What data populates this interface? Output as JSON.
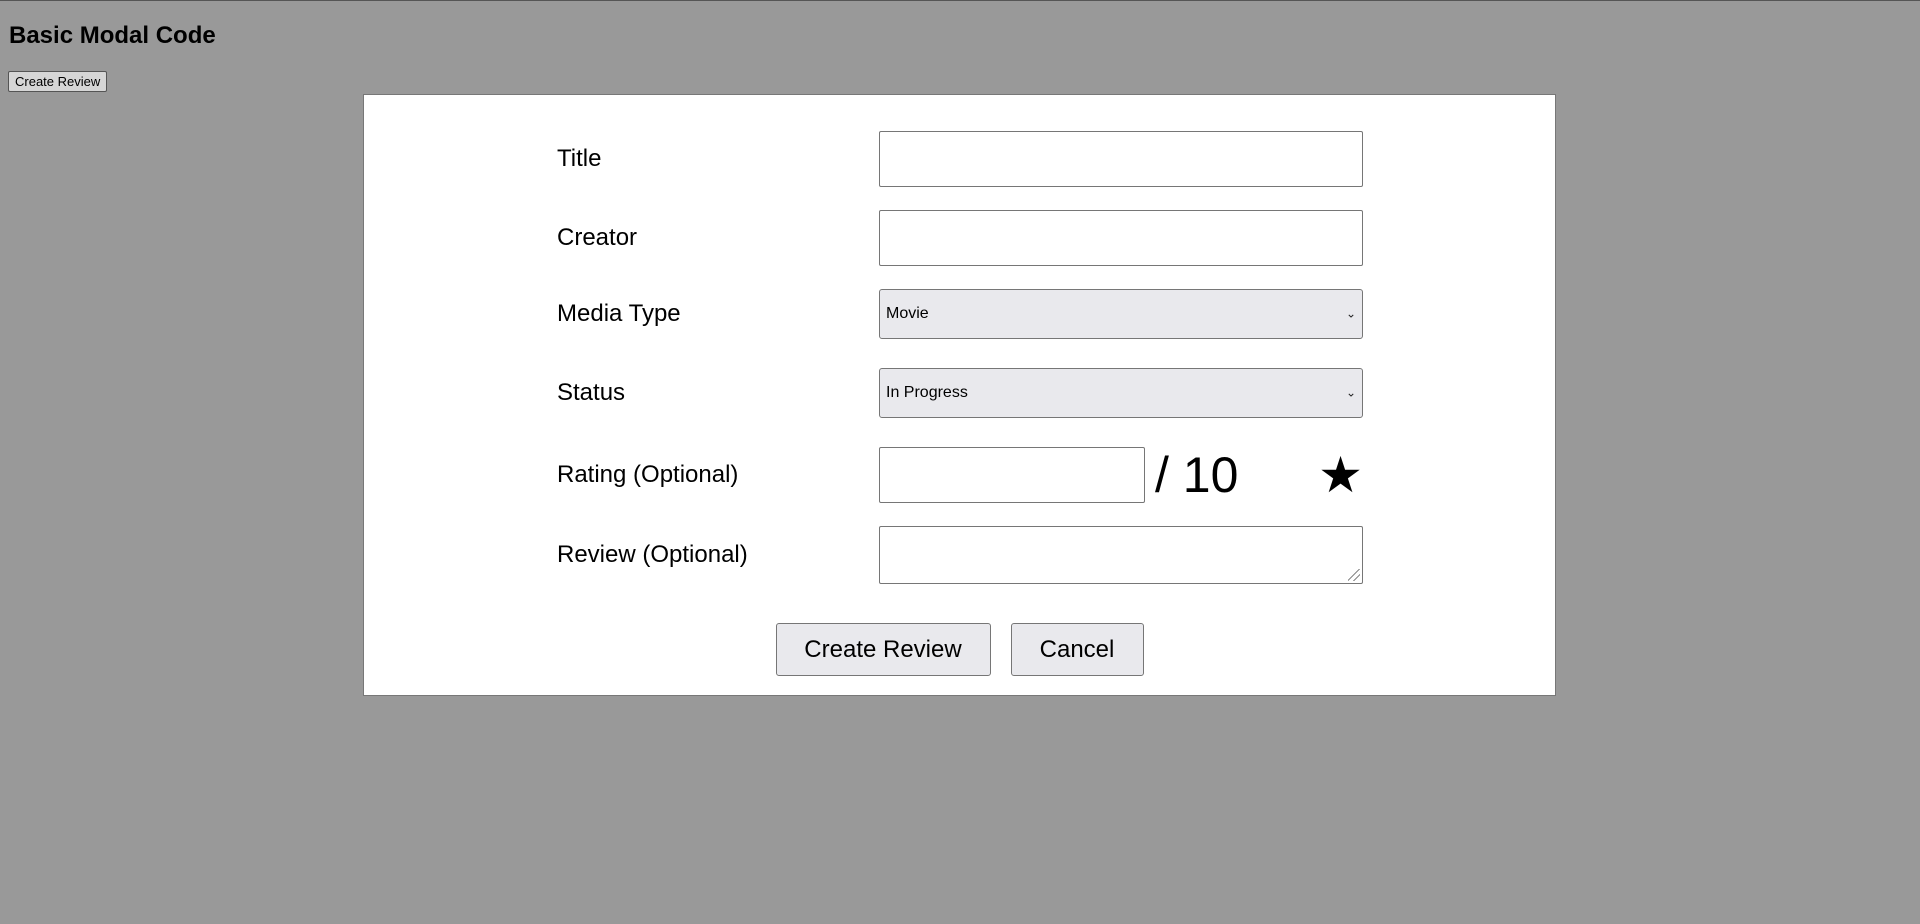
{
  "page": {
    "title": "Basic Modal Code",
    "open_button_label": "Create Review"
  },
  "modal": {
    "fields": {
      "title": {
        "label": "Title",
        "value": ""
      },
      "creator": {
        "label": "Creator",
        "value": ""
      },
      "media_type": {
        "label": "Media Type",
        "selected": "Movie"
      },
      "status": {
        "label": "Status",
        "selected": "In Progress"
      },
      "rating": {
        "label": "Rating (Optional)",
        "value": "",
        "suffix": "/ 10",
        "icon": "star-icon"
      },
      "review": {
        "label": "Review (Optional)",
        "value": ""
      }
    },
    "actions": {
      "create_label": "Create Review",
      "cancel_label": "Cancel"
    }
  }
}
